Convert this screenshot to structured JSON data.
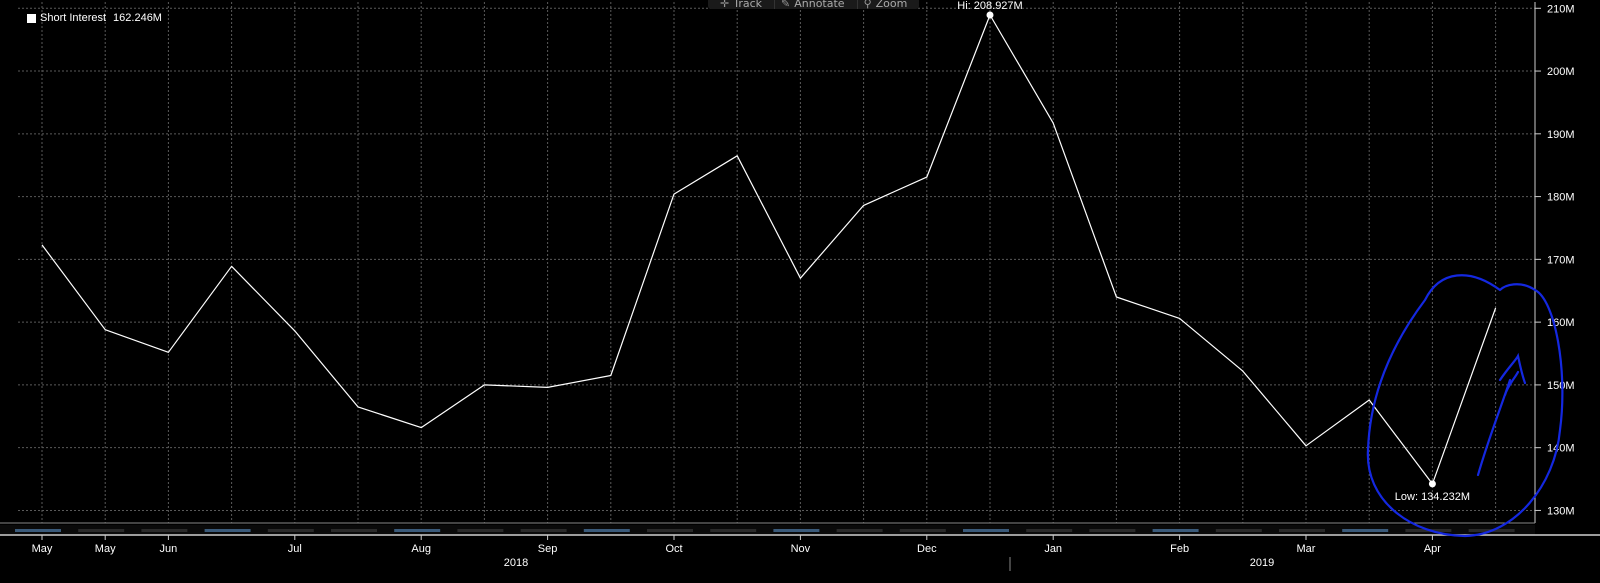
{
  "toolbar": {
    "items": [
      {
        "label": "Track",
        "icon": "crosshair-icon"
      },
      {
        "label": "Annotate",
        "icon": "pencil-icon"
      },
      {
        "label": "Zoom",
        "icon": "magnifier-icon"
      }
    ]
  },
  "legend": {
    "label": "Short Interest",
    "value": "162.246M"
  },
  "colors": {
    "background": "#000000",
    "line": "#ffffff",
    "grid": "#5a5a5a",
    "annotation": "#1428e0",
    "axis_text": "#ffffff"
  },
  "chart_data": {
    "type": "line",
    "title": "",
    "xlabel": "",
    "ylabel": "",
    "x_tick_labels": [
      "May",
      "May",
      "Jun",
      "Jul",
      "Aug",
      "Sep",
      "Oct",
      "Nov",
      "Dec",
      "Jan",
      "Feb",
      "Mar",
      "Apr"
    ],
    "x_year_labels": [
      "2018",
      "2019"
    ],
    "y_tick_labels": [
      "130M",
      "140M",
      "150M",
      "160M",
      "170M",
      "180M",
      "190M",
      "200M",
      "210M"
    ],
    "ylim": [
      128,
      211
    ],
    "grid": true,
    "series": [
      {
        "name": "Short Interest",
        "values": [
          172.3,
          158.8,
          155.2,
          168.9,
          158.6,
          146.5,
          143.2,
          150.0,
          149.6,
          151.5,
          180.4,
          186.5,
          167.0,
          178.6,
          183.1,
          208.927,
          191.7,
          164.0,
          160.6,
          152.2,
          140.3,
          147.6,
          134.232,
          162.246
        ]
      }
    ],
    "annotations": [
      {
        "label": "Hi: 208.927M",
        "value": 208.927
      },
      {
        "label": "Low: 134.232M",
        "value": 134.232
      }
    ]
  }
}
